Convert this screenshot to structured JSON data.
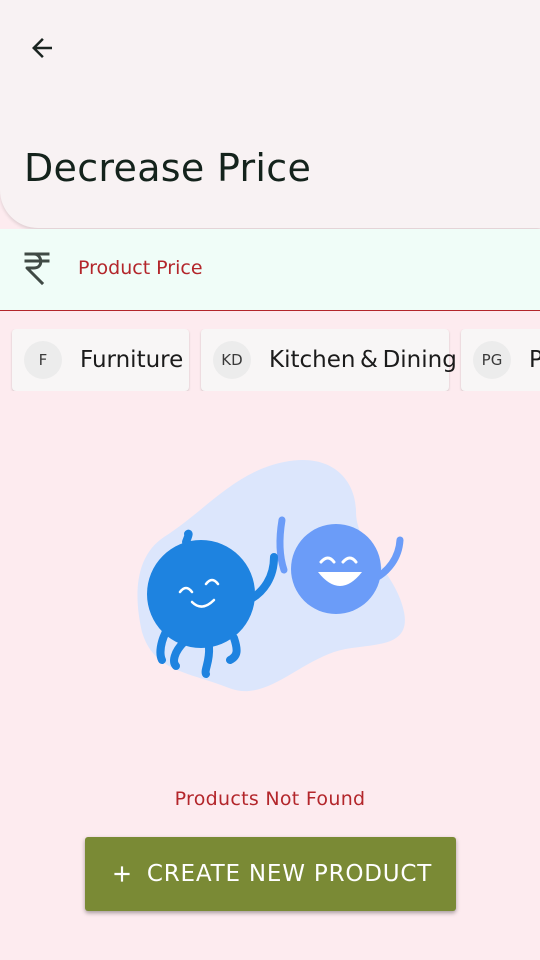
{
  "header": {
    "title": "Decrease Price",
    "back_icon": "arrow-left-icon"
  },
  "price_field": {
    "icon": "rupee-icon",
    "placeholder": "Product Price"
  },
  "categories": [
    {
      "initials": "F",
      "label": "Furniture"
    },
    {
      "initials": "KD",
      "label": "Kitchen & Dining"
    },
    {
      "initials": "PG",
      "label": "P"
    }
  ],
  "empty_state": {
    "message": "Products Not Found"
  },
  "create_button": {
    "icon": "plus-icon",
    "label": "CREATE NEW PRODUCT"
  },
  "colors": {
    "background": "#fdebef",
    "header": "#f8f2f3",
    "accent_error": "#b3262b",
    "button": "#7a8a35",
    "blob": "#dce6fc",
    "character_dark": "#1e83e0",
    "character_light": "#6b9cf8"
  }
}
